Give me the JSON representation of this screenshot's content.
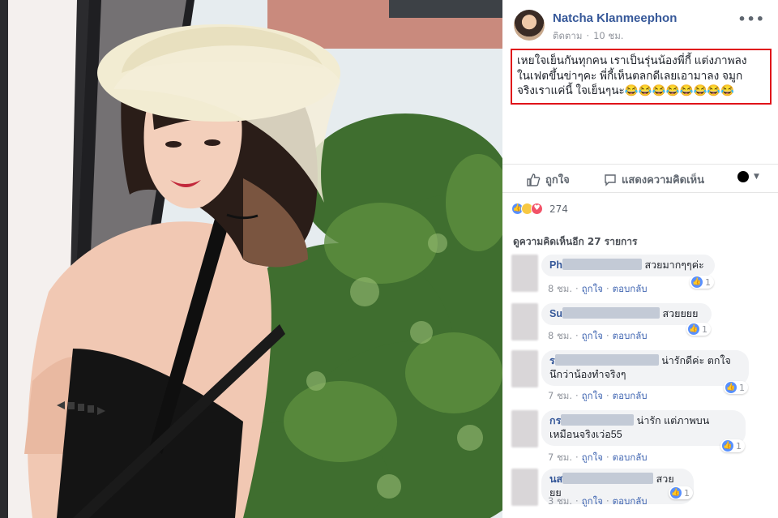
{
  "post": {
    "author": "Natcha Klanmeephon",
    "follow": "ติดตาม",
    "time": "10 ชม.",
    "more_icon": "•••",
    "text": "เหยใจเย็นกันทุกคน เราเป็นรุ่นน้องพี่กี้ แต่งภาพลง\nในเฟตขึ้นข่าๆคะ พี่กี้เห็นตลกดีเลยเอามาลง จมูก\nจริงเราแค่นี้ ใจเย็นๆนะ😂😂😂😂😂😂😂😂"
  },
  "actions": {
    "like": "ถูกใจ",
    "comment": "แสดงความคิดเห็น"
  },
  "reactions": {
    "count": "274"
  },
  "view_more": "ดูความคิดเห็นอีก 27 รายการ",
  "comments": [
    {
      "name": "Ph",
      "text": "สวยมากๆๆค่ะ",
      "time": "8 ชม.",
      "like": "ถูกใจ",
      "reply": "ตอบกลับ",
      "likes": "1"
    },
    {
      "name": "Su",
      "text": "สวยยยย",
      "time": "8 ชม.",
      "like": "ถูกใจ",
      "reply": "ตอบกลับ",
      "likes": "1"
    },
    {
      "name": "ร",
      "text": "น่ารักดีค่ะ ตกใจ",
      "text2": "นึกว่าน้องทำจริงๆ",
      "time": "7 ชม.",
      "like": "ถูกใจ",
      "reply": "ตอบกลับ",
      "likes": "1"
    },
    {
      "name": "กร",
      "text": "น่ารัก แต่ภาพบน",
      "text2": "เหมือนจริงเว่อ55",
      "time": "7 ชม.",
      "like": "ถูกใจ",
      "reply": "ตอบกลับ",
      "likes": "1"
    },
    {
      "name": "นส",
      "text": "สวยยย",
      "time": "3 ชม.",
      "like": "ถูกใจ",
      "reply": "ตอบกลับ",
      "likes": "1"
    }
  ],
  "colors": {
    "link": "#365899",
    "highlight_border": "#e0131a",
    "like_blue": "#5890ff"
  }
}
